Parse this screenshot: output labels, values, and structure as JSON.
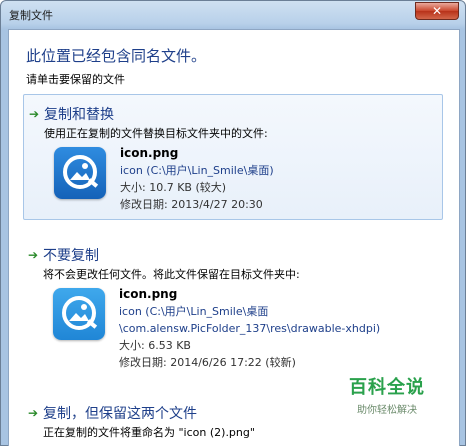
{
  "window": {
    "title": "复制文件",
    "close_symbol": "✕"
  },
  "header": {
    "headline": "此位置已经包含同名文件。",
    "instruction": "请单击要保留的文件"
  },
  "options": [
    {
      "title": "复制和替换",
      "description": "使用正在复制的文件替换目标文件夹中的文件:",
      "file": {
        "name": "icon.png",
        "path_lines": [
          "icon (C:\\用户\\Lin_Smile\\桌面)"
        ],
        "size": "大小: 10.7 KB (较大)",
        "modified": "修改日期: 2013/4/27 20:30"
      }
    },
    {
      "title": "不要复制",
      "description": "将不会更改任何文件。将此文件保留在目标文件夹中:",
      "file": {
        "name": "icon.png",
        "path_lines": [
          "icon (C:\\用户\\Lin_Smile\\桌面",
          "\\com.alensw.PicFolder_137\\res\\drawable-xhdpi)"
        ],
        "size": "大小: 6.53 KB",
        "modified": "修改日期: 2014/6/26 17:22 (较新)"
      }
    },
    {
      "title": "复制，但保留这两个文件",
      "description": "正在复制的文件将重命名为 \"icon (2).png\""
    }
  ],
  "watermark": {
    "title": "百科全说",
    "subtitle": "助你轻松解决"
  },
  "colors": {
    "accent_blue": "#1e3f8a",
    "arrow_green": "#2a8a2a",
    "watermark_green": "#2aa14c"
  }
}
